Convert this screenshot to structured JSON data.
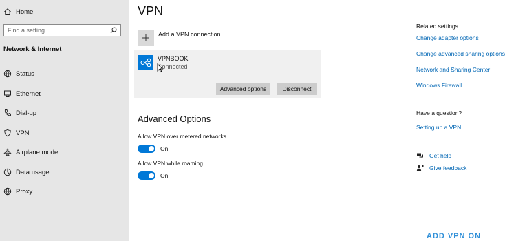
{
  "sidebar": {
    "home_label": "Home",
    "search_placeholder": "Find a setting",
    "section_title": "Network & Internet",
    "items": [
      {
        "label": "Status"
      },
      {
        "label": "Ethernet"
      },
      {
        "label": "Dial-up"
      },
      {
        "label": "VPN"
      },
      {
        "label": "Airplane mode"
      },
      {
        "label": "Data usage"
      },
      {
        "label": "Proxy"
      }
    ]
  },
  "main": {
    "title": "VPN",
    "add_label": "Add a VPN connection",
    "connection": {
      "name": "VPNBOOK",
      "status": "Connected",
      "advanced_button": "Advanced options",
      "disconnect_button": "Disconnect"
    },
    "advanced": {
      "title": "Advanced Options",
      "options": [
        {
          "label": "Allow VPN over metered networks",
          "state": "On"
        },
        {
          "label": "Allow VPN while roaming",
          "state": "On"
        }
      ]
    }
  },
  "related": {
    "title": "Related settings",
    "links": [
      "Change adapter options",
      "Change advanced sharing options",
      "Network and Sharing Center",
      "Windows Firewall"
    ],
    "question_title": "Have a question?",
    "question_link": "Setting up a VPN",
    "get_help": "Get help",
    "give_feedback": "Give feedback"
  },
  "watermark": "ADD VPN ON",
  "colors": {
    "accent": "#0078d7",
    "link": "#0066b4",
    "sidebar_bg": "#e6e6e6",
    "card_bg": "#f0f0f0"
  }
}
